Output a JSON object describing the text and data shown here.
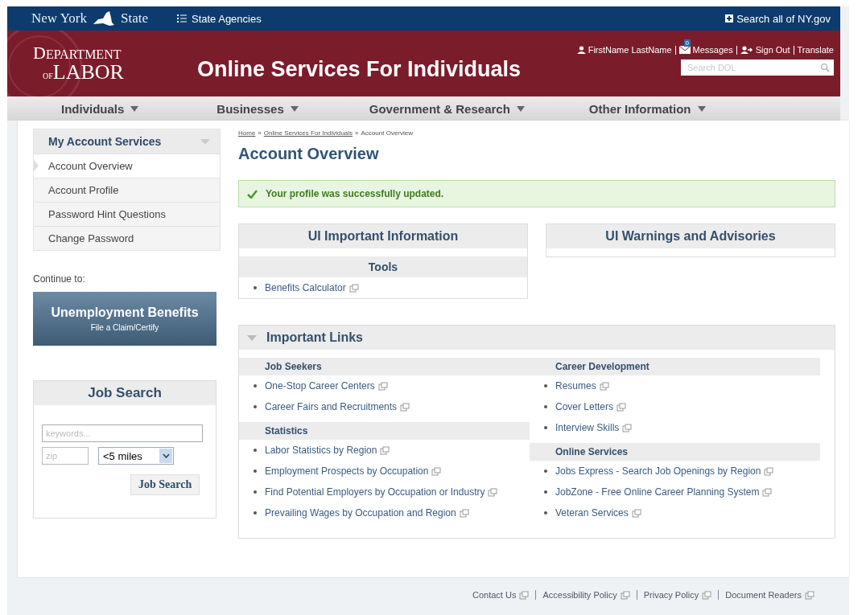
{
  "top_bar": {
    "brand_left": "New York",
    "brand_right": "State",
    "agencies": "State Agencies",
    "search_all": "Search all of NY.gov"
  },
  "header": {
    "logo_top": "DEPARTMENT",
    "logo_of": "OF",
    "logo_bottom": "LABOR",
    "title": "Online Services For Individuals",
    "user": "FirstName LastName",
    "messages": "Messages",
    "message_count": "0",
    "sign_out": "Sign Out",
    "translate": "Translate",
    "search_placeholder": "Search DOL"
  },
  "nav": [
    {
      "label": "Individuals"
    },
    {
      "label": "Businesses"
    },
    {
      "label": "Government & Research"
    },
    {
      "label": "Other Information"
    }
  ],
  "sidebar": {
    "menu_title": "My Account Services",
    "items": [
      {
        "label": "Account Overview",
        "selected": true
      },
      {
        "label": "Account Profile",
        "selected": false
      },
      {
        "label": "Password Hint Questions",
        "selected": false
      },
      {
        "label": "Change Password",
        "selected": false
      }
    ],
    "continue_label": "Continue to:",
    "benefits_title": "Unemployment Benefits",
    "benefits_sub": "File a Claim/Certify",
    "job_search": {
      "title": "Job Search",
      "keywords_placeholder": "keywords...",
      "zip_placeholder": "zip",
      "distance": "<5 miles",
      "button": "Job Search"
    }
  },
  "main": {
    "breadcrumb": [
      {
        "label": "Home",
        "link": true
      },
      {
        "label": "Online Services For Individuals",
        "link": true
      },
      {
        "label": "Account Overview",
        "link": false
      }
    ],
    "breadcrumb_separator": "»",
    "heading": "Account Overview",
    "alert": "Your profile was successfully updated.",
    "boxes": [
      {
        "title": "UI Important Information",
        "subtitle": "Tools",
        "links": [
          "Benefits Calculator"
        ]
      },
      {
        "title": "UI Warnings and Advisories"
      }
    ],
    "links_panel": {
      "title": "Important Links",
      "columns": [
        [
          {
            "title": "Job Seekers",
            "links": [
              "One-Stop Career Centers",
              "Career Fairs and Recruitments"
            ]
          },
          {
            "title": "Statistics",
            "links": [
              "Labor Statistics by Region",
              "Employment Prospects by Occupation",
              "Find Potential Employers by Occupation or Industry",
              "Prevailing Wages by Occupation and Region"
            ]
          }
        ],
        [
          {
            "title": "Career Development",
            "links": [
              "Resumes",
              "Cover Letters",
              "Interview Skills"
            ]
          },
          {
            "title": "Online Services",
            "links": [
              "Jobs Express - Search Job Openings by Region",
              "JobZone - Free Online Career Planning System",
              "Veteran Services"
            ]
          }
        ]
      ]
    }
  },
  "footer": [
    "Contact Us",
    "Accessibility Policy",
    "Privacy Policy",
    "Document Readers"
  ]
}
